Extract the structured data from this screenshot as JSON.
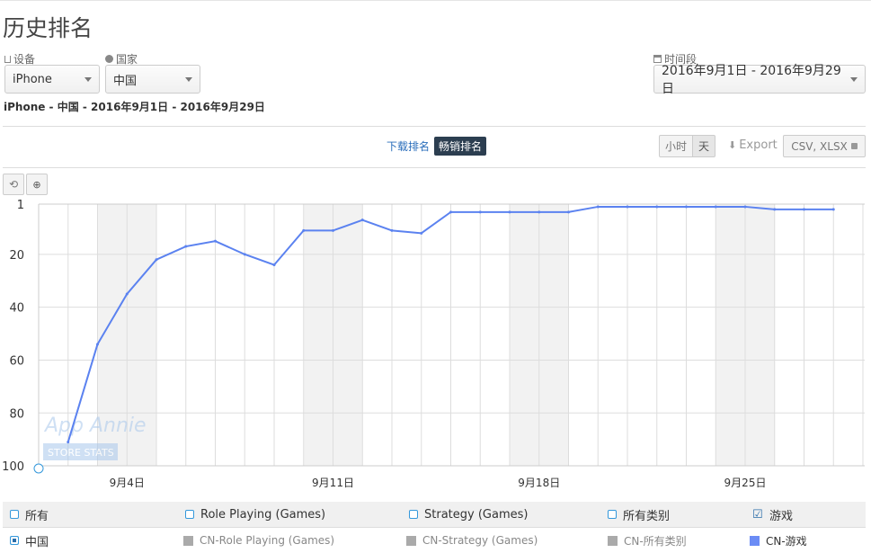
{
  "page": {
    "title": "历史排名",
    "subtitle": "iPhone - 中国 - 2016年9月1日 - 2016年9月29日"
  },
  "filters": {
    "device_label": "设备",
    "device_value": "iPhone",
    "country_label": "国家",
    "country_value": "中国",
    "period_label": "时间段",
    "period_value": "2016年9月1日 - 2016年9月29日"
  },
  "tabs": [
    {
      "label": "下载排名",
      "active": false
    },
    {
      "label": "畅销排名",
      "active": true
    }
  ],
  "granularity": {
    "hour": "小时",
    "day": "天",
    "selected": "天"
  },
  "export": {
    "label": "Export",
    "formats": "CSV, XLSX"
  },
  "watermark": {
    "line1": "App Annie",
    "line2": "STORE STATS"
  },
  "colors": {
    "series": "#5b82f0",
    "accent": "#3498db",
    "active_tab": "#2c3e50",
    "weekend": "#f2f2f2",
    "inactive": "#aaaaaa"
  },
  "chart_data": {
    "type": "line",
    "title": "",
    "xlabel": "",
    "ylabel": "",
    "y_inverted": true,
    "ylim": [
      1,
      100
    ],
    "yticks": [
      "1",
      "20",
      "40",
      "60",
      "80",
      "100"
    ],
    "xlim": [
      "2016-09-01",
      "2016-09-29"
    ],
    "xticks": [
      "9月4日",
      "9月11日",
      "9月18日",
      "9月25日"
    ],
    "xtick_days": [
      4,
      11,
      18,
      25
    ],
    "shaded_ranges": [
      [
        3,
        5
      ],
      [
        10,
        12
      ],
      [
        17,
        19
      ],
      [
        24,
        26
      ]
    ],
    "grid": true,
    "series": [
      {
        "name": "CN-游戏",
        "x": [
          2,
          3,
          4,
          5,
          6,
          7,
          8,
          9,
          10,
          11,
          12,
          13,
          14,
          15,
          16,
          17,
          18,
          19,
          20,
          21,
          22,
          23,
          24,
          25,
          26,
          27,
          28
        ],
        "values": [
          91,
          54,
          35,
          22,
          17,
          15,
          20,
          24,
          11,
          11,
          7,
          11,
          12,
          4,
          4,
          4,
          4,
          4,
          2,
          2,
          2,
          2,
          2,
          2,
          3,
          3,
          3
        ]
      }
    ]
  },
  "legend": {
    "categories": [
      {
        "label": "所有",
        "checked": false
      },
      {
        "label": "Role Playing (Games)",
        "checked": false
      },
      {
        "label": "Strategy (Games)",
        "checked": false
      },
      {
        "label": "所有类别",
        "checked": false
      },
      {
        "label": "游戏",
        "checked": true
      }
    ],
    "country": {
      "label": "中国",
      "checked": true
    },
    "series": [
      "CN-Role Playing (Games)",
      "CN-Strategy (Games)",
      "CN-所有类别",
      "CN-游戏"
    ]
  }
}
